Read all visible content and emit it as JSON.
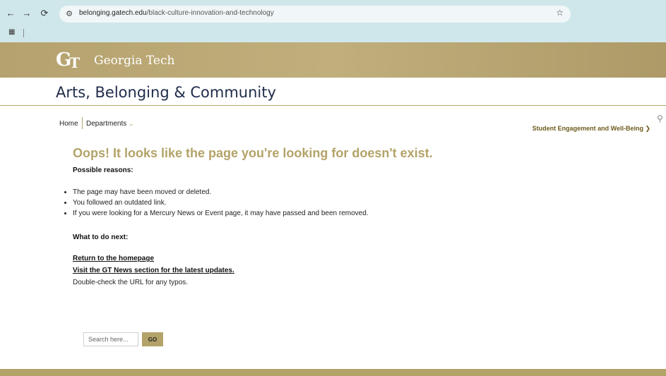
{
  "browser": {
    "url_host": "belonging.gatech.edu",
    "url_path": "/black-culture-innovation-and-technology",
    "back_glyph": "←",
    "forward_glyph": "→",
    "reload_glyph": "⟳",
    "star_glyph": "☆",
    "apps_glyph": "▦"
  },
  "banner": {
    "logo_mark_g": "G",
    "logo_mark_t": "T",
    "logo_text": "Georgia Tech"
  },
  "site": {
    "title": "Arts, Belonging & Community"
  },
  "nav": {
    "home": "Home",
    "departments": "Departments",
    "departments_chevron": "⌄",
    "student_engagement": "Student Engagement and Well-Being ❯",
    "search_glyph": "⚲"
  },
  "content": {
    "error_title": "Oops! It looks like the page you're looking for doesn't exist.",
    "reasons_label": "Possible reasons:",
    "reasons": [
      "The page may have been moved or deleted.",
      "You followed an outdated link.",
      "If you were looking for a Mercury News or Event page, it may have passed and been removed."
    ],
    "next_label": "What to do next:",
    "link_home": "Return to the homepage",
    "link_news": "Visit the GT News section for the latest updates.",
    "check_url": "Double-check the URL for any typos."
  },
  "search": {
    "placeholder": "Search here...",
    "go_label": "GO"
  },
  "colors": {
    "gold": "#b3a369",
    "navy": "#1f2b4a",
    "chrome": "#cfe7ea"
  }
}
